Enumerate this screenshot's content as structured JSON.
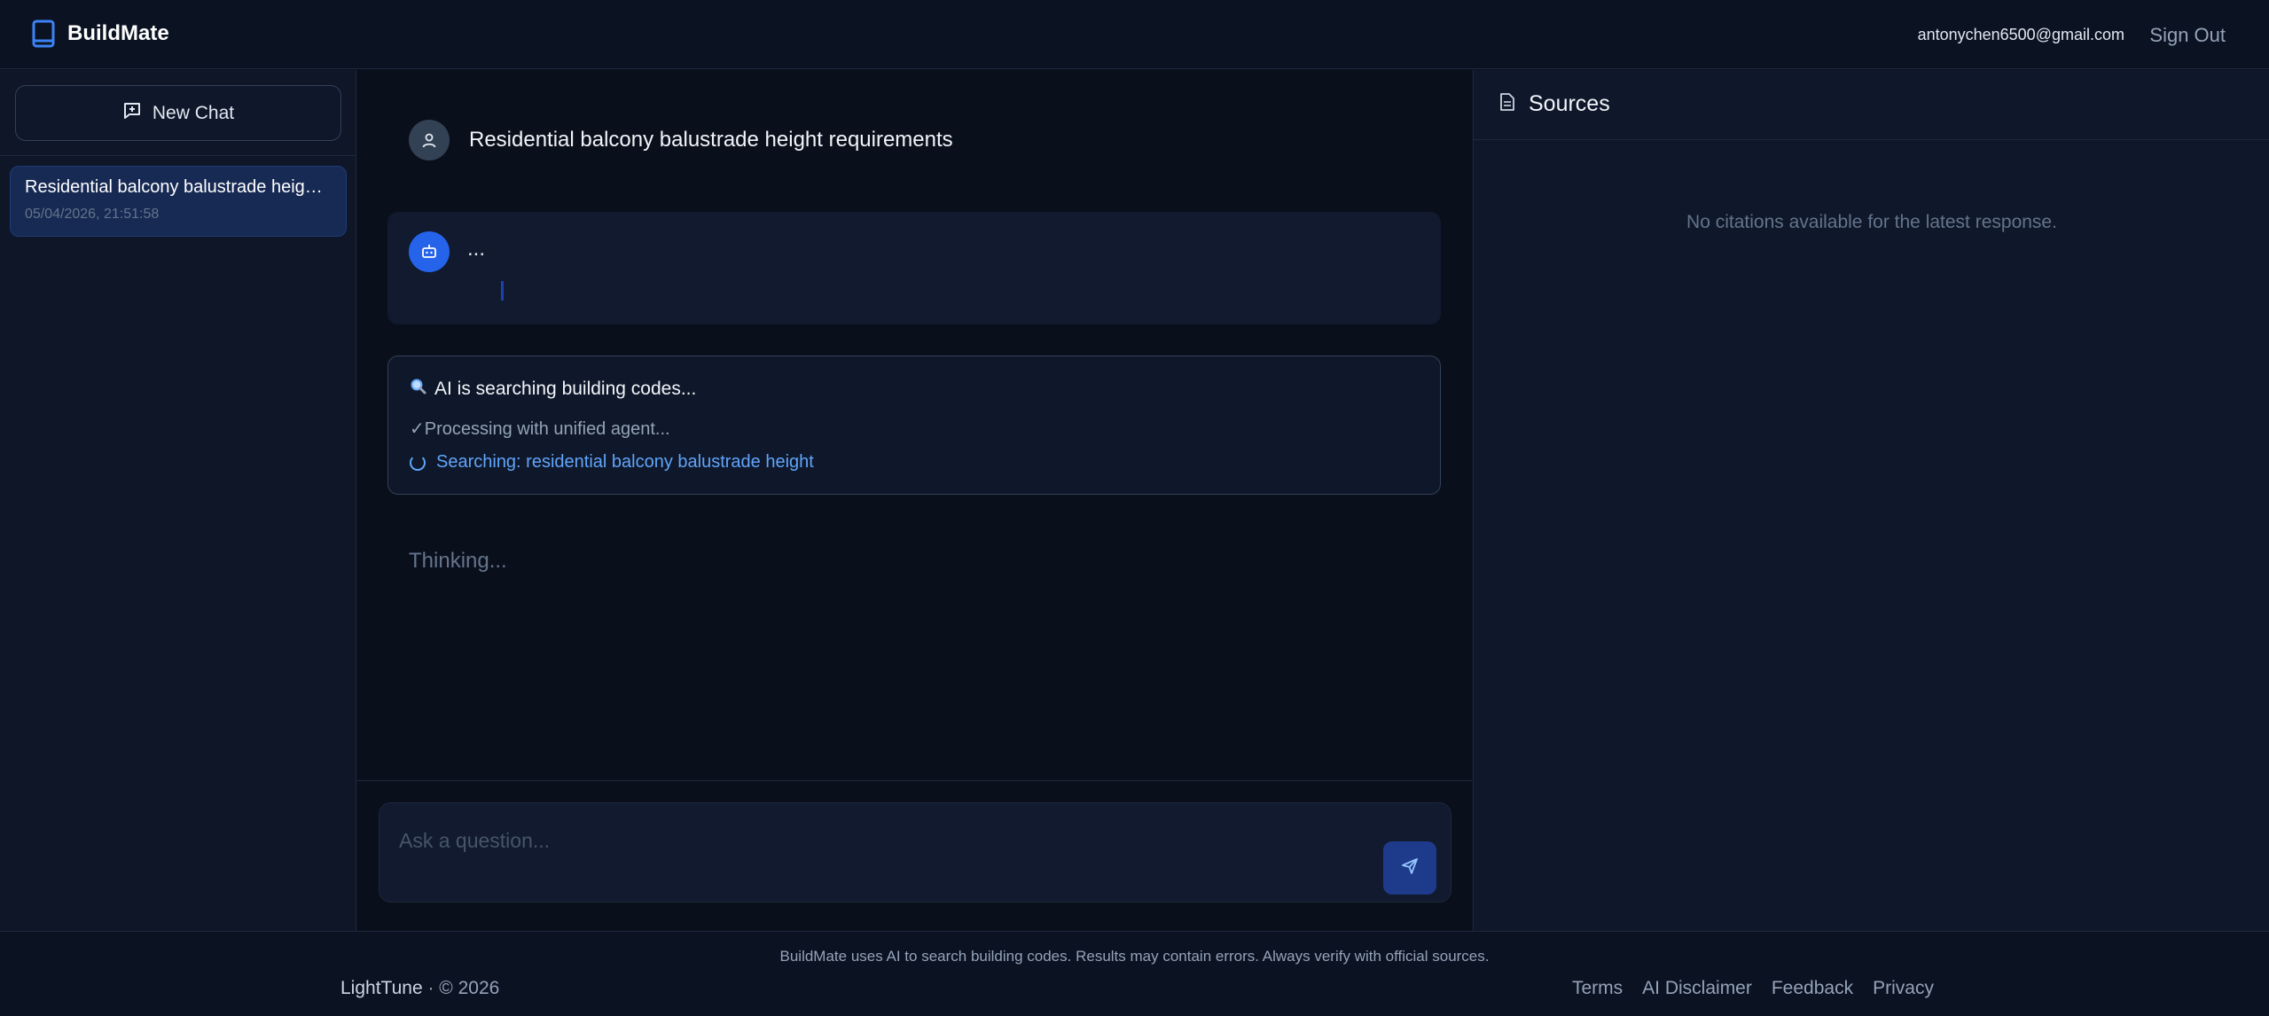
{
  "header": {
    "brand": "BuildMate",
    "user_email": "antonychen6500@gmail.com",
    "sign_out": "Sign Out"
  },
  "sidebar": {
    "new_chat_label": "New Chat",
    "chats": [
      {
        "title": "Residential balcony balustrade height requirements",
        "timestamp": "05/04/2026, 21:51:58"
      }
    ]
  },
  "conversation": {
    "user_message": "Residential balcony balustrade height requirements",
    "bot_message": "...",
    "status": {
      "title": "AI is searching building codes...",
      "done_step": "✓Processing with unified agent...",
      "active_step": "Searching: residential balcony balustrade height"
    },
    "thinking": "Thinking..."
  },
  "input": {
    "placeholder": "Ask a question...",
    "value": ""
  },
  "sources": {
    "title": "Sources",
    "empty_message": "No citations available for the latest response."
  },
  "footer": {
    "disclaimer": "BuildMate uses AI to search building codes. Results may contain errors. Always verify with official sources.",
    "company": "LightTune",
    "copyright": "· © 2026",
    "links": [
      "Terms",
      "AI Disclaimer",
      "Feedback",
      "Privacy"
    ]
  },
  "colors": {
    "accent": "#2563eb",
    "link_blue": "#60a5fa",
    "background": "#0b1120"
  }
}
